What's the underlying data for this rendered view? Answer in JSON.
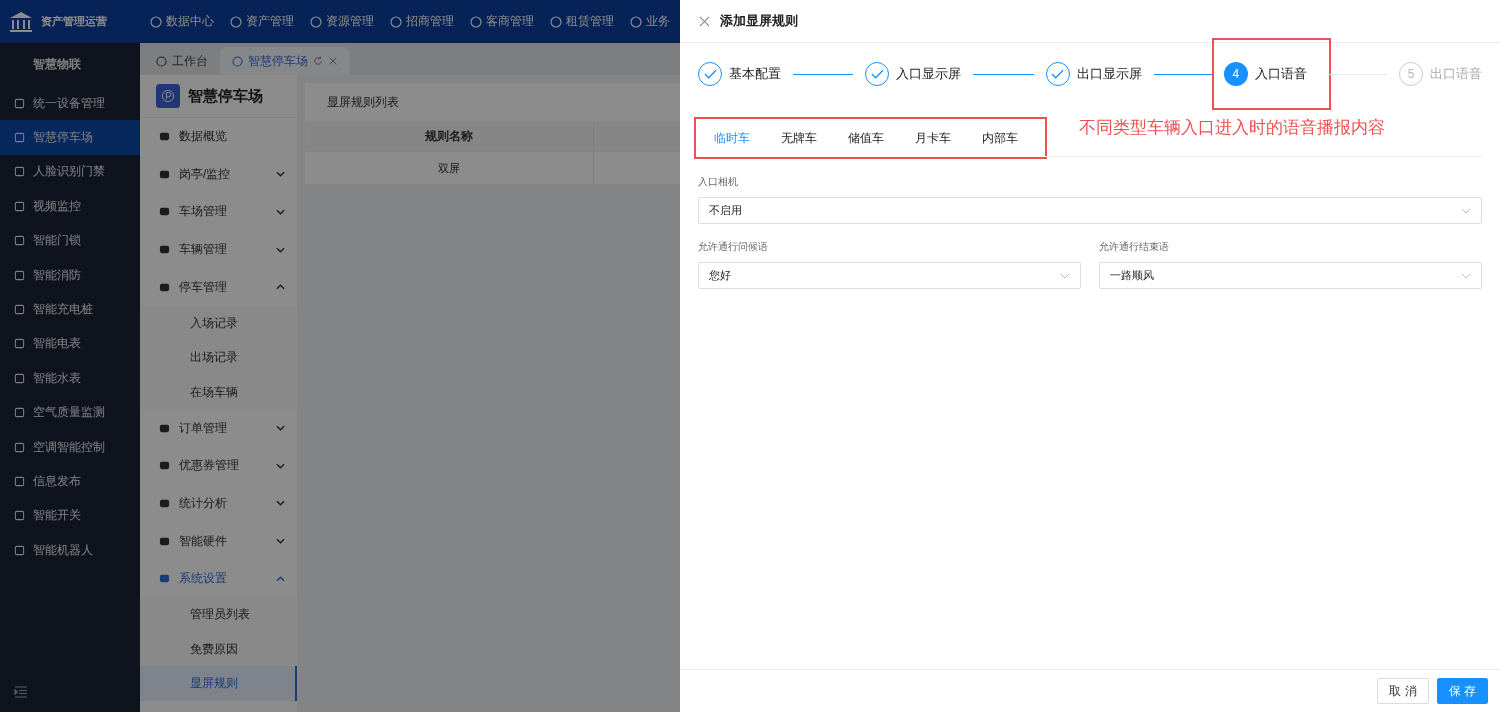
{
  "topbar": {
    "brand": "资产管理运营",
    "nav": [
      "数据中心",
      "资产管理",
      "资源管理",
      "招商管理",
      "客商管理",
      "租赁管理",
      "业务"
    ]
  },
  "sidebar": {
    "group": "智慧物联",
    "items": [
      {
        "label": "统一设备管理",
        "selected": false
      },
      {
        "label": "智慧停车场",
        "selected": true
      },
      {
        "label": "人脸识别门禁",
        "selected": false
      },
      {
        "label": "视频监控",
        "selected": false
      },
      {
        "label": "智能门锁",
        "selected": false
      },
      {
        "label": "智能消防",
        "selected": false
      },
      {
        "label": "智能充电桩",
        "selected": false
      },
      {
        "label": "智能电表",
        "selected": false
      },
      {
        "label": "智能水表",
        "selected": false
      },
      {
        "label": "空气质量监测",
        "selected": false
      },
      {
        "label": "空调智能控制",
        "selected": false
      },
      {
        "label": "信息发布",
        "selected": false
      },
      {
        "label": "智能开关",
        "selected": false
      },
      {
        "label": "智能机器人",
        "selected": false
      }
    ]
  },
  "page_tabs": [
    {
      "label": "工作台",
      "selected": false
    },
    {
      "label": "智慧停车场",
      "selected": true
    }
  ],
  "submenu": {
    "title": "智慧停车场",
    "items": [
      {
        "label": "数据概览"
      },
      {
        "label": "岗亭/监控",
        "expanded": false
      },
      {
        "label": "车场管理",
        "expanded": false
      },
      {
        "label": "车辆管理",
        "expanded": false
      },
      {
        "label": "停车管理",
        "expanded": true,
        "children": [
          {
            "label": "入场记录",
            "selected": false
          },
          {
            "label": "出场记录",
            "selected": false
          },
          {
            "label": "在场车辆",
            "selected": false
          }
        ]
      },
      {
        "label": "订单管理",
        "expanded": false
      },
      {
        "label": "优惠券管理",
        "expanded": false
      },
      {
        "label": "统计分析",
        "expanded": false
      },
      {
        "label": "智能硬件",
        "expanded": false
      },
      {
        "label": "系统设置",
        "expanded": true,
        "active": true,
        "children": [
          {
            "label": "管理员列表",
            "selected": false
          },
          {
            "label": "免费原因",
            "selected": false
          },
          {
            "label": "显屏规则",
            "selected": true
          }
        ]
      }
    ]
  },
  "list_card": {
    "title": "显屏规则列表",
    "columns": [
      "规则名称"
    ],
    "rows": [
      [
        "双屏"
      ]
    ]
  },
  "drawer": {
    "title": "添加显屏规则",
    "steps": [
      {
        "label": "基本配置",
        "finished": true,
        "highlighted": false
      },
      {
        "label": "入口显示屏",
        "finished": true,
        "highlighted": false
      },
      {
        "label": "出口显示屏",
        "finished": true,
        "highlighted": false
      },
      {
        "label": "入口语音",
        "finished": false,
        "current": true,
        "number": "4",
        "highlighted": true
      },
      {
        "label": "出口语音",
        "finished": false,
        "current": false,
        "number": "5",
        "highlighted": false
      }
    ],
    "tabs_highlighted": true,
    "tabs": [
      {
        "label": "临时车",
        "selected": true
      },
      {
        "label": "无牌车",
        "selected": false
      },
      {
        "label": "储值车",
        "selected": false
      },
      {
        "label": "月卡车",
        "selected": false
      },
      {
        "label": "内部车",
        "selected": false
      }
    ],
    "annotation": "不同类型车辆入口进入时的语音播报内容",
    "camera": {
      "label": "入口相机",
      "value": "不启用"
    },
    "greeting": {
      "label": "允许通行问候语",
      "value": "您好"
    },
    "farewell": {
      "label": "允许通行结束语",
      "value": "一路顺风"
    },
    "buttons": [
      {
        "label": "取 消",
        "kind": "default"
      },
      {
        "label": "保 存",
        "kind": "primary"
      }
    ]
  }
}
